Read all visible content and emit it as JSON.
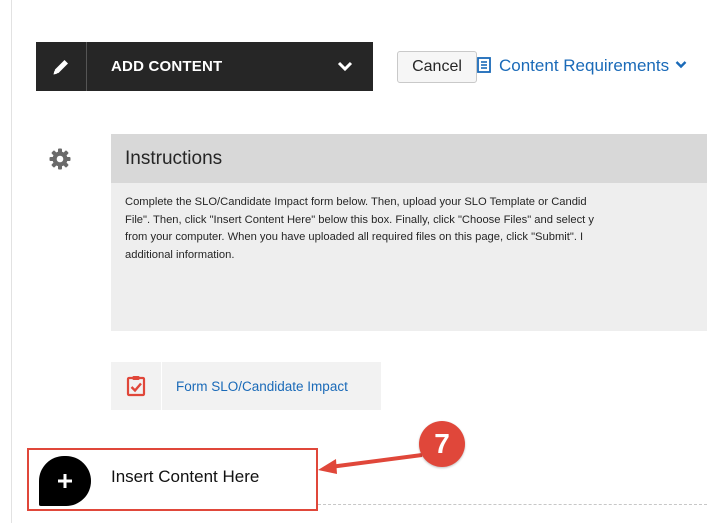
{
  "toolbar": {
    "add_content_label": "ADD CONTENT",
    "cancel_label": "Cancel",
    "content_requirements_label": "Content Requirements",
    "icons": [
      "pencil-icon",
      "chevron-down-icon",
      "document-icon"
    ]
  },
  "instructions": {
    "title": "Instructions",
    "lines": [
      "Complete the SLO/Candidate Impact form below.  Then, upload your SLO Template or Candid",
      "File\".  Then, click \"Insert Content Here\" below this box.  Finally, click \"Choose Files\" and select y",
      "from your computer.  When you have uploaded all required files on this page, click \"Submit\".  I",
      "additional information."
    ]
  },
  "form_item": {
    "label": "Form SLO/Candidate Impact",
    "icon": "clipboard-check-icon"
  },
  "insert": {
    "label": "Insert Content Here",
    "icon": "plus-icon"
  },
  "annotation": {
    "step_number": "7",
    "color": "#e0473a"
  },
  "colors": {
    "toolbar_bg": "#262626",
    "link": "#1a6ab8",
    "panel_header": "#d8d8d8",
    "panel_body": "#eeeeee"
  }
}
